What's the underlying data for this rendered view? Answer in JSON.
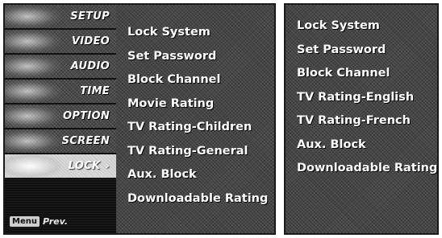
{
  "left_panel": {
    "tabs": [
      {
        "label": "SETUP",
        "icon": "setup-thumb-icon",
        "active": false
      },
      {
        "label": "VIDEO",
        "icon": "video-thumb-icon",
        "active": false
      },
      {
        "label": "AUDIO",
        "icon": "audio-thumb-icon",
        "active": false
      },
      {
        "label": "TIME",
        "icon": "time-thumb-icon",
        "active": false
      },
      {
        "label": "OPTION",
        "icon": "option-thumb-icon",
        "active": false
      },
      {
        "label": "SCREEN",
        "icon": "screen-thumb-icon",
        "active": false
      },
      {
        "label": "LOCK",
        "icon": "lock-thumb-icon",
        "active": true
      }
    ],
    "active_arrow": "›",
    "footer": {
      "key_label": "Menu",
      "text": "Prev."
    },
    "menu_items": [
      "Lock System",
      "Set Password",
      "Block Channel",
      "Movie Rating",
      "TV Rating-Children",
      "TV Rating-General",
      "Aux. Block",
      "Downloadable Rating"
    ]
  },
  "right_panel": {
    "menu_items": [
      "Lock System",
      "Set Password",
      "Block Channel",
      "TV Rating-English",
      "TV Rating-French",
      "Aux. Block",
      "Downloadable Rating"
    ]
  }
}
